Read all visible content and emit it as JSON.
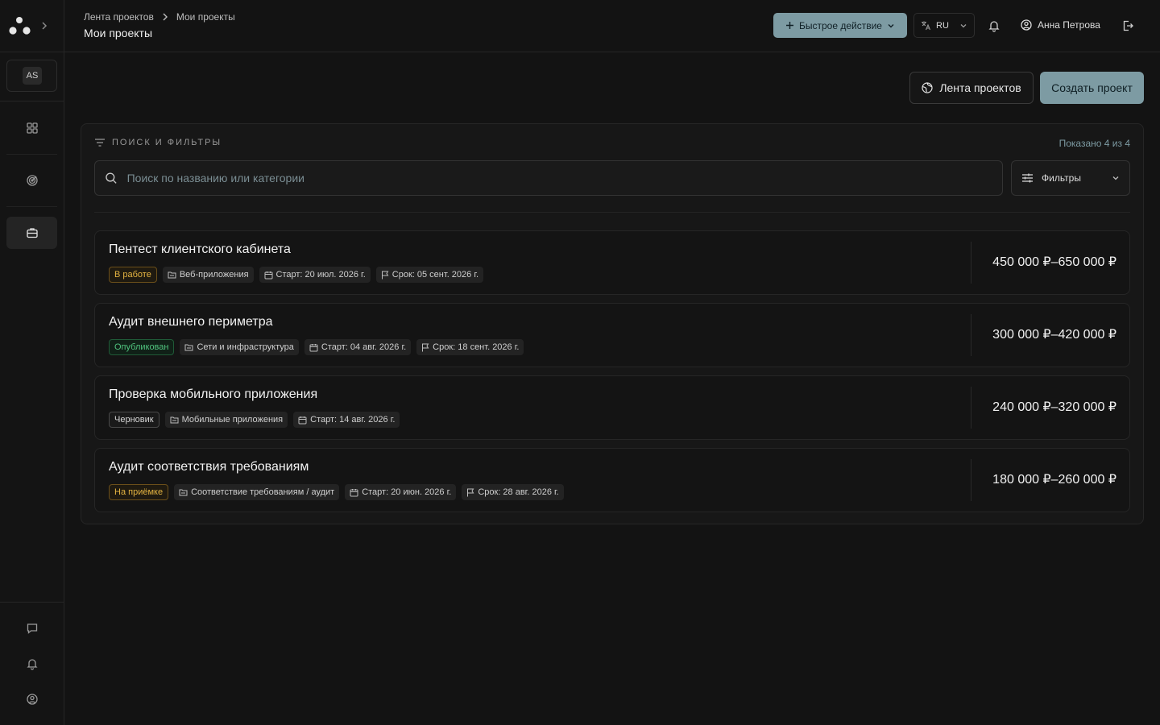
{
  "sidebar": {
    "workspace_initials": "AS"
  },
  "header": {
    "breadcrumb": [
      "Лента проектов",
      "Мои проекты"
    ],
    "title": "Мои проекты",
    "quick_action": "Быстрое действие",
    "language": "RU",
    "user_name": "Анна Петрова"
  },
  "actions": {
    "feed_label": "Лента проектов",
    "create_label": "Создать проект"
  },
  "filters": {
    "title": "ПОИСК И ФИЛЬТРЫ",
    "shown": "Показано 4 из 4",
    "search_placeholder": "Поиск по названию или категории",
    "filters_label": "Фильтры"
  },
  "projects": [
    {
      "title": "Пентест клиентского кабинета",
      "status": "В работе",
      "category": "Веб-приложения",
      "start": "Старт: 20 июл. 2026 г.",
      "deadline": "Срок: 05 сент. 2026 г.",
      "price": "450 000 ₽–650 000 ₽"
    },
    {
      "title": "Аудит внешнего периметра",
      "status": "Опубликован",
      "category": "Сети и инфраструктура",
      "start": "Старт: 04 авг. 2026 г.",
      "deadline": "Срок: 18 сент. 2026 г.",
      "price": "300 000 ₽–420 000 ₽"
    },
    {
      "title": "Проверка мобильного приложения",
      "status": "Черновик",
      "category": "Мобильные приложения",
      "start": "Старт: 14 авг. 2026 г.",
      "price": "240 000 ₽–320 000 ₽"
    },
    {
      "title": "Аудит соответствия требованиям",
      "status": "На приёмке",
      "category": "Соответствие требованиям / аудит",
      "start": "Старт: 20 июн. 2026 г.",
      "deadline": "Срок: 28 авг. 2026 г.",
      "price": "180 000 ₽–260 000 ₽"
    }
  ]
}
